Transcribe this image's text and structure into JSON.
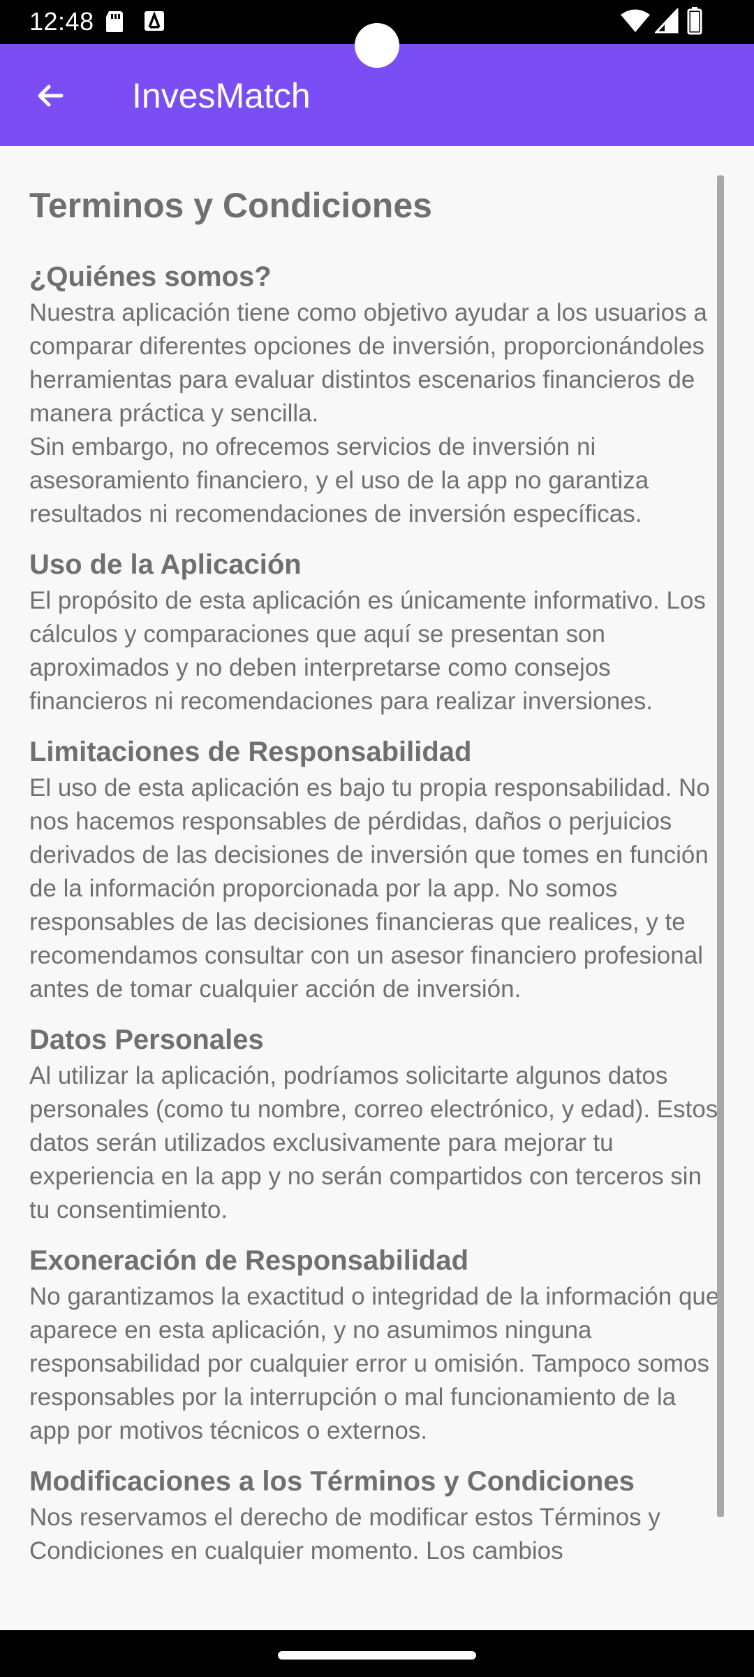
{
  "status_bar": {
    "time": "12:48",
    "icons": [
      "sd-card-icon",
      "accessibility-icon",
      "wifi-icon",
      "signal-icon",
      "battery-icon"
    ]
  },
  "app_bar": {
    "title": "InvesMatch",
    "back_icon": "arrow-left-icon",
    "background": "#7b4df5"
  },
  "content": {
    "heading": "Terminos y Condiciones",
    "sections": [
      {
        "title": "¿Quiénes somos?",
        "body": "Nuestra aplicación tiene como objetivo ayudar a los usuarios a comparar diferentes opciones de inversión, proporcionándoles herramientas para evaluar distintos escenarios financieros de manera práctica y sencilla.\nSin embargo, no ofrecemos servicios de inversión ni asesoramiento financiero, y el uso de la app no garantiza resultados ni recomendaciones de inversión específicas."
      },
      {
        "title": "Uso de la Aplicación",
        "body": "El propósito de esta aplicación es únicamente informativo. Los cálculos y comparaciones que aquí se presentan son aproximados y no deben interpretarse como consejos financieros ni recomendaciones para realizar inversiones."
      },
      {
        "title": "Limitaciones de Responsabilidad",
        "body": "El uso de esta aplicación es bajo tu propia responsabilidad. No nos hacemos responsables de pérdidas, daños o perjuicios derivados de las decisiones de inversión que tomes en función de la información proporcionada por la app. No somos responsables de las decisiones financieras que realices, y te recomendamos consultar con un asesor financiero profesional antes de tomar cualquier acción de inversión."
      },
      {
        "title": "Datos Personales",
        "body": "Al utilizar la aplicación, podríamos solicitarte algunos datos personales (como tu nombre, correo electrónico, y edad). Estos datos serán utilizados exclusivamente para mejorar tu experiencia en la app y no serán compartidos con terceros sin tu consentimiento."
      },
      {
        "title": "Exoneración de Responsabilidad",
        "body": "No garantizamos la exactitud o integridad de la información que aparece en esta aplicación, y no asumimos ninguna responsabilidad por cualquier error u omisión. Tampoco somos responsables por la interrupción o mal funcionamiento de la app por motivos técnicos o externos."
      },
      {
        "title": "Modificaciones a los Términos y Condiciones",
        "body": "Nos reservamos el derecho de modificar estos Términos y Condiciones en cualquier momento. Los cambios"
      }
    ]
  }
}
